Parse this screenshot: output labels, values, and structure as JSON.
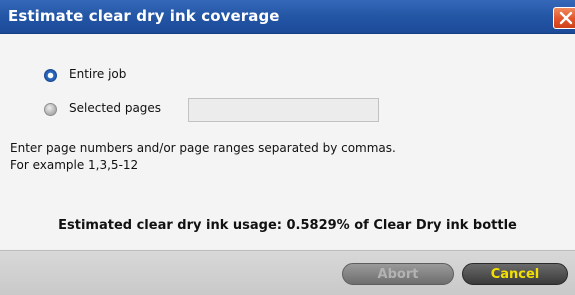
{
  "dialog": {
    "title": "Estimate clear dry ink coverage"
  },
  "options": {
    "entire_job_label": "Entire job",
    "selected_pages_label": "Selected pages",
    "selected": "Entire job",
    "pages_value": ""
  },
  "hint": {
    "line1": "Enter page numbers and/or page ranges separated by commas.",
    "line2": "For example 1,3,5-12"
  },
  "result": {
    "usage_text": "Estimated clear dry ink usage: 0.5829% of Clear Dry ink bottle"
  },
  "buttons": {
    "abort_label": "Abort",
    "cancel_label": "Cancel"
  },
  "colors": {
    "titlebar": "#2456a6",
    "close_button": "#e2542a",
    "cancel_text": "#f3e000"
  }
}
